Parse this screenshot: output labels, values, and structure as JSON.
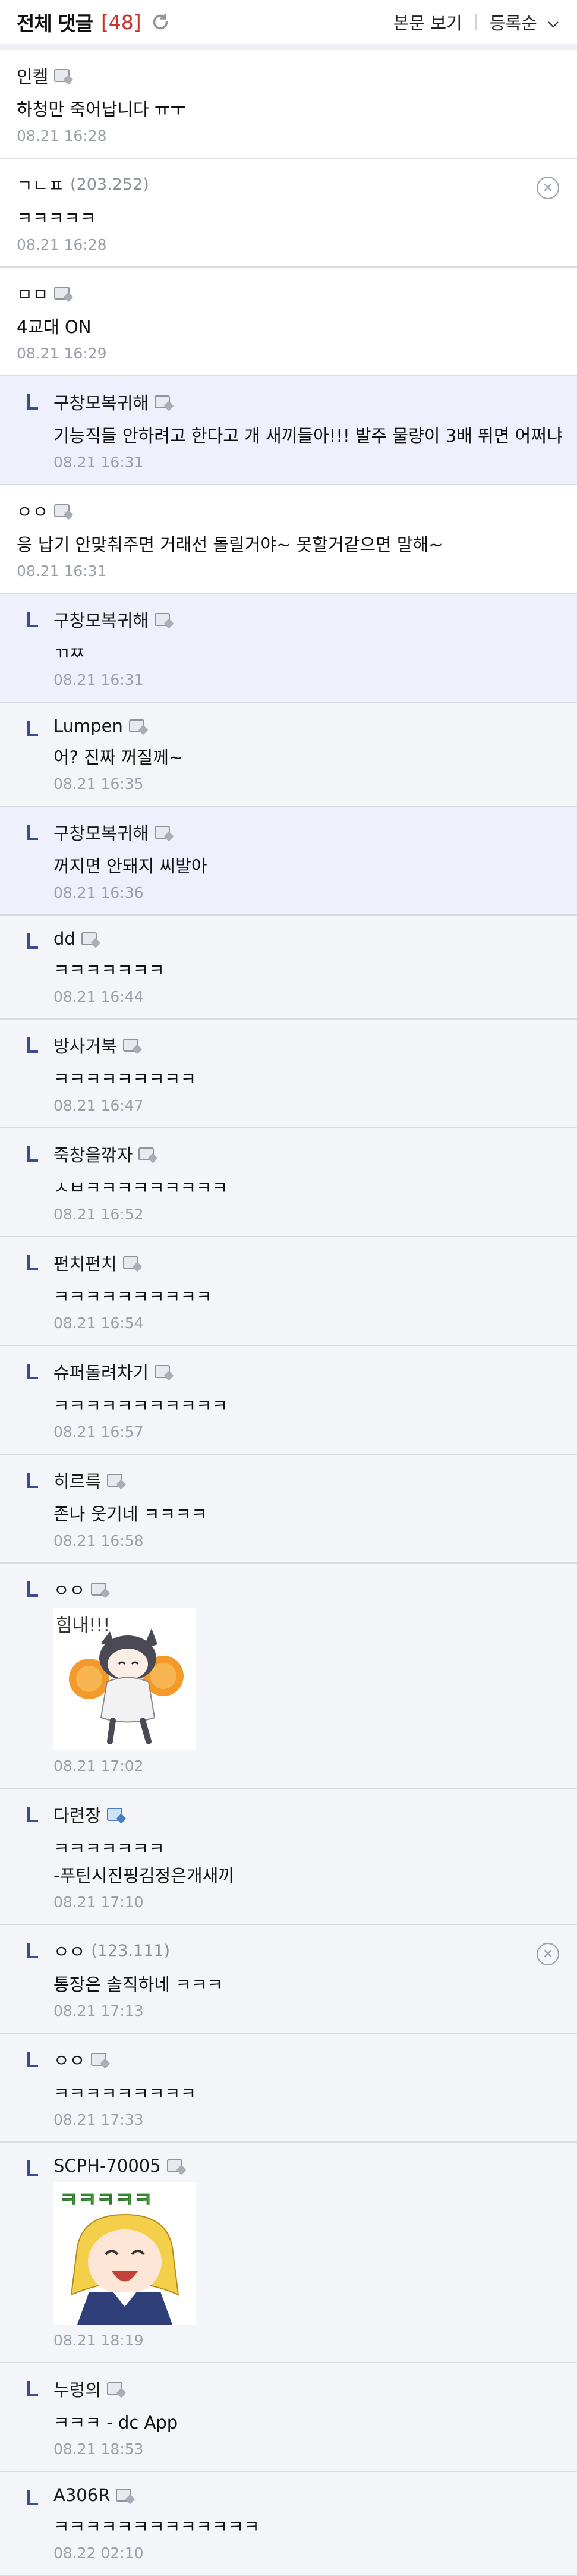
{
  "header": {
    "title": "전체 댓글",
    "count": "[48]",
    "view_label": "본문 보기",
    "sort_label": "등록순"
  },
  "comments": [
    {
      "type": "top",
      "nick": "인켈",
      "ip": "",
      "body": "하청만 죽어납니다 ㅠㅜ",
      "date": "08.21 16:28",
      "gallog": "gray",
      "del": false
    },
    {
      "type": "top",
      "nick": "ㄱㄴㅍ",
      "ip": "(203.252)",
      "body": "ㅋㅋㅋㅋㅋ",
      "date": "08.21 16:28",
      "gallog": "",
      "del": true
    },
    {
      "type": "top",
      "nick": "ㅁㅁ",
      "ip": "",
      "body": "4교대 ON",
      "date": "08.21 16:29",
      "gallog": "gray",
      "del": false
    },
    {
      "type": "rep",
      "hl": true,
      "nick": "구창모복귀해",
      "ip": "",
      "body": "기능직들 안하려고 한다고 개 새끼들아!!! 발주 물량이 3배 뛰면 어쩌냐",
      "date": "08.21 16:31",
      "gallog": "gray",
      "del": false
    },
    {
      "type": "top",
      "nick": "ㅇㅇ",
      "ip": "",
      "body": "응 납기 안맞춰주면 거래선 돌릴거야~ 못할거같으면 말해~",
      "date": "08.21 16:31",
      "gallog": "gray",
      "del": false
    },
    {
      "type": "rep",
      "hl": true,
      "nick": "구창모복귀해",
      "ip": "",
      "body": "ㄲㅉ",
      "date": "08.21 16:31",
      "gallog": "gray",
      "del": false
    },
    {
      "type": "rep",
      "hl": false,
      "nick": "Lumpen",
      "ip": "",
      "body": "어? 진짜 꺼질께~",
      "date": "08.21 16:35",
      "gallog": "gray",
      "del": false
    },
    {
      "type": "rep",
      "hl": true,
      "nick": "구창모복귀해",
      "ip": "",
      "body": "꺼지면 안돼지 씨발아",
      "date": "08.21 16:36",
      "gallog": "gray",
      "del": false
    },
    {
      "type": "rep",
      "hl": false,
      "nick": "dd",
      "ip": "",
      "body": "ㅋㅋㅋㅋㅋㅋㅋ",
      "date": "08.21 16:44",
      "gallog": "gray",
      "del": false
    },
    {
      "type": "rep",
      "hl": false,
      "nick": "방사거북",
      "ip": "",
      "body": "ㅋㅋㅋㅋㅋㅋㅋㅋㅋ",
      "date": "08.21 16:47",
      "gallog": "gray",
      "del": false
    },
    {
      "type": "rep",
      "hl": false,
      "nick": "죽창을깎자",
      "ip": "",
      "body": "ㅅㅂㅋㅋㅋㅋㅋㅋㅋㅋㅋ",
      "date": "08.21 16:52",
      "gallog": "gray",
      "del": false
    },
    {
      "type": "rep",
      "hl": false,
      "nick": "펀치펀치",
      "ip": "",
      "body": "ㅋㅋㅋㅋㅋㅋㅋㅋㅋㅋ",
      "date": "08.21 16:54",
      "gallog": "gray",
      "del": false
    },
    {
      "type": "rep",
      "hl": false,
      "nick": "슈퍼돌려차기",
      "ip": "",
      "body": "ㅋㅋㅋㅋㅋㅋㅋㅋㅋㅋㅋ",
      "date": "08.21 16:57",
      "gallog": "gray",
      "del": false
    },
    {
      "type": "rep",
      "hl": false,
      "nick": "히르륵",
      "ip": "",
      "body": "존나 웃기네 ㅋㅋㅋㅋ",
      "date": "08.21 16:58",
      "gallog": "gray",
      "del": false
    },
    {
      "type": "rep",
      "hl": false,
      "nick": "ㅇㅇ",
      "ip": "",
      "body": "",
      "date": "08.21 17:02",
      "gallog": "gray",
      "del": false,
      "dccon": "cheer",
      "dccon_text": "힘내!!!"
    },
    {
      "type": "rep",
      "hl": false,
      "nick": "다련장",
      "ip": "",
      "body": "ㅋㅋㅋㅋㅋㅋㅋ",
      "body2": "-푸틴시진핑김정은개새끼",
      "date": "08.21 17:10",
      "gallog": "blue",
      "del": false
    },
    {
      "type": "rep",
      "hl": false,
      "nick": "ㅇㅇ",
      "ip": "(123.111)",
      "body": "통장은 솔직하네 ㅋㅋㅋ",
      "date": "08.21 17:13",
      "gallog": "",
      "del": true
    },
    {
      "type": "rep",
      "hl": false,
      "nick": "ㅇㅇ",
      "ip": "",
      "body": "ㅋㅋㅋㅋㅋㅋㅋㅋㅋ",
      "date": "08.21 17:33",
      "gallog": "gray",
      "del": false
    },
    {
      "type": "rep",
      "hl": false,
      "nick": "SCPH-70005",
      "ip": "",
      "body": "",
      "date": "08.21 18:19",
      "gallog": "gray",
      "del": false,
      "dccon": "laugh",
      "dccon_text": "ㅋㅋㅋㅋㅋ"
    },
    {
      "type": "rep",
      "hl": false,
      "nick": "누렁의",
      "ip": "",
      "body": "ㅋㅋㅋ - dc App",
      "date": "08.21 18:53",
      "gallog": "gray",
      "del": false
    },
    {
      "type": "rep",
      "hl": false,
      "nick": "A306R",
      "ip": "",
      "body": "ㅋㅋㅋㅋㅋㅋㅋㅋㅋㅋㅋㅋㅋ",
      "date": "08.22 02:10",
      "gallog": "gray",
      "del": false
    }
  ]
}
